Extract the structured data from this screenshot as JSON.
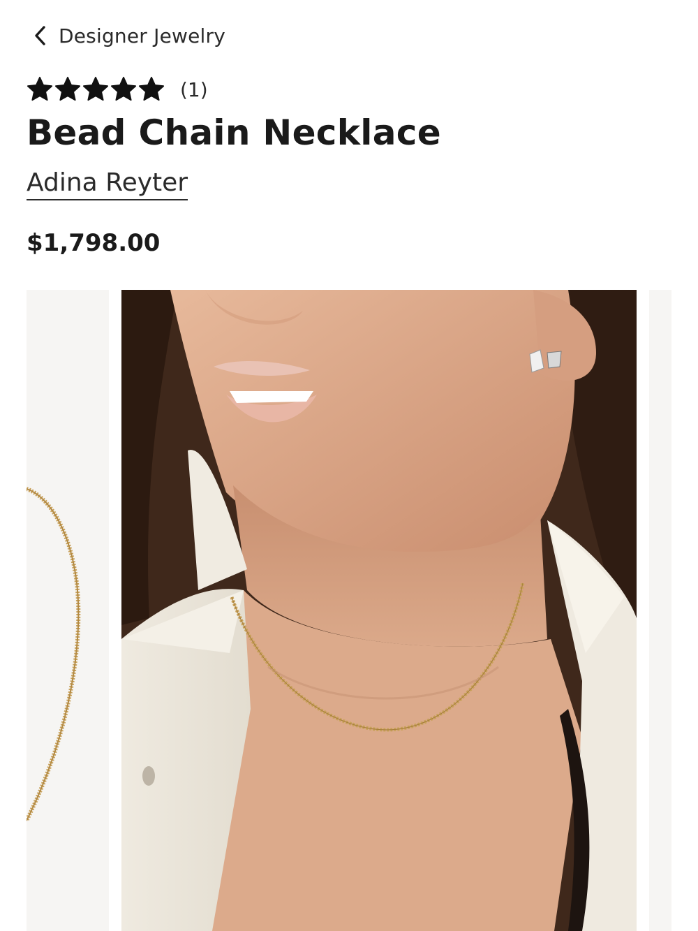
{
  "header": {
    "breadcrumb_label": "Designer Jewelry",
    "back_icon": "chevron-left-icon"
  },
  "product": {
    "rating": 5,
    "rating_max": 5,
    "star_icon": "star-icon",
    "review_count": "(1)",
    "title": "Bead Chain Necklace",
    "brand": "Adina Reyter",
    "price": "$1,798.00"
  },
  "gallery": {
    "images": [
      "necklace-product-shot",
      "model-wearing-necklace",
      "next-product-shot"
    ],
    "active_index": 1
  },
  "colors": {
    "text": "#1a1a1a",
    "gold": "#c9a25a",
    "jacket": "#f1ede4",
    "hair": "#3a2418",
    "skin": "#dcab8c"
  }
}
